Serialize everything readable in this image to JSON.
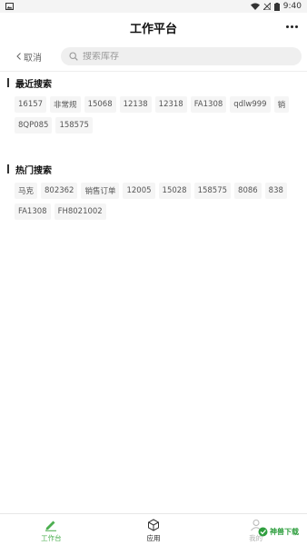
{
  "status_bar": {
    "time": "9:40"
  },
  "header": {
    "title": "工作平台"
  },
  "search": {
    "cancel_label": "取消",
    "placeholder": "搜索库存",
    "value": ""
  },
  "recent": {
    "title": "最近搜索",
    "tags": [
      "16157",
      "非常规",
      "15068",
      "12138",
      "12318",
      "FA1308",
      "qdlw999",
      "销",
      "8QP085",
      "158575"
    ]
  },
  "hot": {
    "title": "热门搜索",
    "tags": [
      "马克",
      "802362",
      "销售订单",
      "12005",
      "15028",
      "158575",
      "8086",
      "838",
      "FA1308",
      "FH8021002"
    ]
  },
  "bottom_nav": {
    "items": [
      {
        "label": "工作台",
        "icon": "pencil-icon",
        "active": true
      },
      {
        "label": "应用",
        "icon": "cube-icon",
        "active": false
      },
      {
        "label": "我的",
        "icon": "user-icon",
        "active": false
      }
    ]
  },
  "watermark": {
    "text": "神兽下载"
  },
  "colors": {
    "accent": "#4caf50",
    "tag_bg": "#f5f5f5",
    "search_bg": "#efefef"
  }
}
